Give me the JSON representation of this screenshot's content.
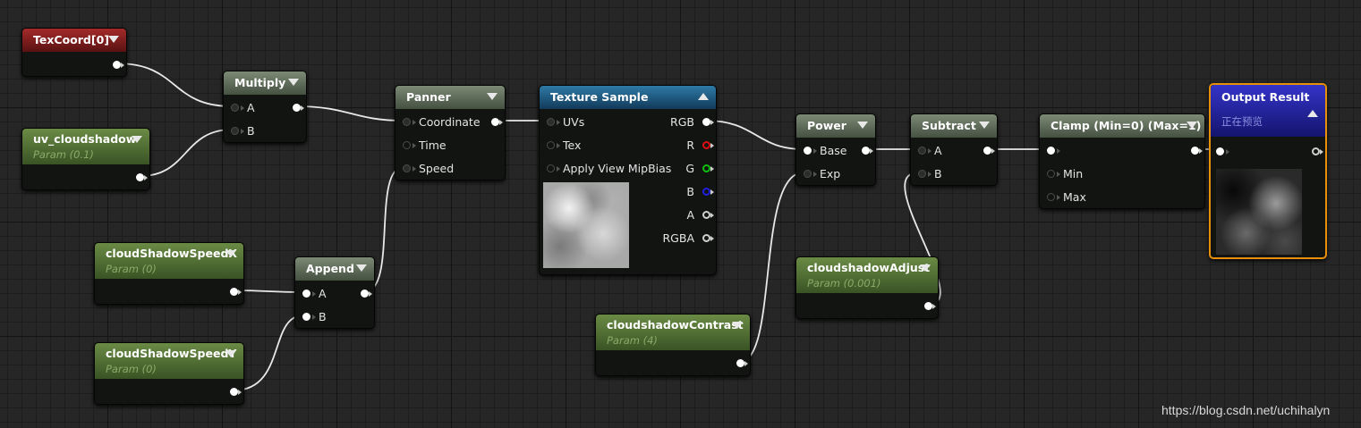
{
  "nodes": {
    "texcoord": {
      "title": "TexCoord[0]"
    },
    "uv_cloudshadow": {
      "title": "uv_cloudshadow",
      "param": "Param (0.1)"
    },
    "multiply": {
      "title": "Multiply",
      "pin_a": "A",
      "pin_b": "B"
    },
    "speedx": {
      "title": "cloudShadowSpeedX",
      "param": "Param (0)"
    },
    "speedy": {
      "title": "cloudShadowSpeedY",
      "param": "Param (0)"
    },
    "append": {
      "title": "Append",
      "pin_a": "A",
      "pin_b": "B"
    },
    "panner": {
      "title": "Panner",
      "pin_coordinate": "Coordinate",
      "pin_time": "Time",
      "pin_speed": "Speed"
    },
    "texture_sample": {
      "title": "Texture Sample",
      "pin_uvs": "UVs",
      "pin_tex": "Tex",
      "pin_mipbias": "Apply View MipBias",
      "out_rgb": "RGB",
      "out_r": "R",
      "out_g": "G",
      "out_b": "B",
      "out_a": "A",
      "out_rgba": "RGBA"
    },
    "contrast": {
      "title": "cloudshadowContrast",
      "param": "Param (4)"
    },
    "power": {
      "title": "Power",
      "pin_base": "Base",
      "pin_exp": "Exp"
    },
    "adjust": {
      "title": "cloudshadowAdjust",
      "param": "Param (0.001)"
    },
    "subtract": {
      "title": "Subtract",
      "pin_a": "A",
      "pin_b": "B"
    },
    "clamp": {
      "title": "Clamp (Min=0) (Max=1)",
      "pin_min": "Min",
      "pin_max": "Max"
    },
    "output": {
      "title": "Output Result",
      "subtitle": "正在预览"
    }
  },
  "watermark": "https://blog.csdn.net/uchihalyn",
  "colors": {
    "background": "#262626",
    "wire": "#e8e8e8",
    "output_border": "#e8900a",
    "pin_r": "#e01010",
    "pin_g": "#10c010",
    "pin_b": "#2020e0"
  }
}
